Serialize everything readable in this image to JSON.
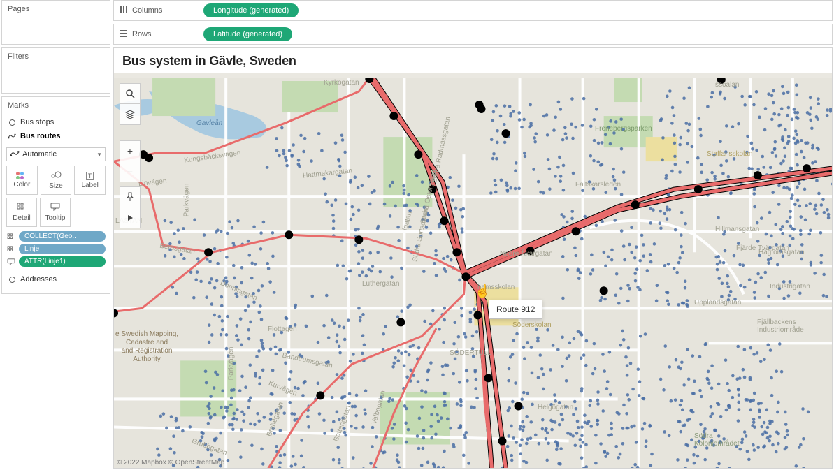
{
  "shelves": {
    "columns_label": "Columns",
    "rows_label": "Rows",
    "columns_pill": "Longitude (generated)",
    "rows_pill": "Latitude (generated)"
  },
  "cards": {
    "pages": "Pages",
    "filters": "Filters",
    "marks": "Marks"
  },
  "layers": {
    "bus_stops": "Bus stops",
    "bus_routes": "Bus routes",
    "addresses": "Addresses"
  },
  "mark_type": "Automatic",
  "encodings": {
    "color": "Color",
    "size": "Size",
    "label": "Label",
    "detail": "Detail",
    "tooltip": "Tooltip"
  },
  "mark_pills": {
    "collect": "COLLECT(Geo..",
    "linje": "Linje",
    "attr_linje": "ATTR(Linje1)"
  },
  "viz": {
    "title": "Bus system in Gävle, Sweden",
    "tooltip_text": "Route 912",
    "attribution": "© 2022 Mapbox © OpenStreetMap",
    "auth_text": "e Swedish Mapping,\nCadastre and\nand Registration\nAuthority"
  },
  "map_labels": {
    "river": "Gavleån",
    "sodertull": "SÖDERTULL",
    "soderskolan": "Söderskolan",
    "freneberg": "Frenebergsparken",
    "staffans": "Staffansskolan",
    "sodra_kolonin": "Södra\nKoloniområdet",
    "fjallbacken": "Fjällbackens\nIndustriområde"
  },
  "streets": {
    "hagtorns": "Hagtornsgatan",
    "upplands": "Upplandsgatan",
    "industri": "Industrigatan",
    "faltskars": "Fältskärsleden",
    "hilmans": "Hillmansgatan",
    "fjarde": "Fjärde Tvärgatan",
    "parkvagen": "Parkvägen",
    "linvagen": "Linvägen",
    "kungsback": "Kungsbäcksvägen",
    "kyrko": "Kyrkogatan",
    "hattmakar": "Hattmakargatan",
    "sodra_sorts": "Södra Sortsgatan",
    "igatan": "Igatan",
    "helgo": "Helgögatan",
    "batteri": "Batterigatan",
    "valbo": "Valbogatan",
    "flottagen": "Flottagen",
    "bergsgatan": "Bergsgatan",
    "lastan": "LASTAN",
    "nedre_a": "Nedre Åkargatan",
    "hemsskolan": "hemsskolan",
    "bandtrum": "Bandtrumsgatan",
    "kurvagen": "Kurvägen",
    "lutherg": "Luthergatan",
    "braheg": "Brahégatan",
    "donning": "Donningatan",
    "grubb": "Grubbgatan",
    "sodra_osg": "Sodra Ostergatan",
    "sodra_rad": "Sodra Radmässgatan",
    "ssoalan": "ssoalan"
  }
}
